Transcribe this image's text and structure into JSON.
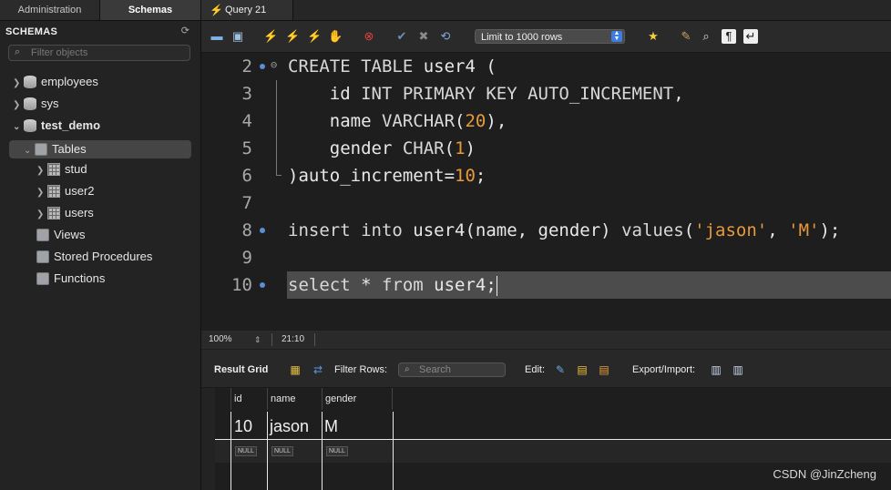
{
  "tabs": {
    "administration": "Administration",
    "schemas": "Schemas",
    "query": "Query 21"
  },
  "sidebar": {
    "title": "SCHEMAS",
    "filter_placeholder": "Filter objects",
    "items": [
      {
        "label": "employees",
        "type": "database",
        "expanded": false
      },
      {
        "label": "sys",
        "type": "database",
        "expanded": false
      },
      {
        "label": "test_demo",
        "type": "database",
        "expanded": true,
        "bold": true
      },
      {
        "label": "Tables",
        "type": "folder",
        "expanded": true,
        "selected": true
      },
      {
        "label": "stud",
        "type": "table"
      },
      {
        "label": "user2",
        "type": "table"
      },
      {
        "label": "users",
        "type": "table"
      },
      {
        "label": "Views",
        "type": "folder"
      },
      {
        "label": "Stored Procedures",
        "type": "folder"
      },
      {
        "label": "Functions",
        "type": "folder"
      }
    ]
  },
  "toolbar": {
    "limit_select": "Limit to 1000 rows",
    "icons": [
      "open-folder-icon",
      "save-icon",
      "execute-bolt-icon",
      "execute-current-bolt-icon",
      "explain-icon",
      "stop-icon",
      "toggle-error-icon",
      "commit-check-icon",
      "rollback-x-icon",
      "autocommit-icon",
      "beautify-star-icon",
      "brush-icon",
      "find-magnifier-icon",
      "invisible-chars-icon",
      "wrap-icon"
    ]
  },
  "editor": {
    "lines": [
      {
        "n": "2",
        "dot": true,
        "fold": true,
        "tokens": [
          [
            "kw",
            "CREATE TABLE "
          ],
          [
            "t",
            "user4 ("
          ]
        ]
      },
      {
        "n": "3",
        "dot": false,
        "tokens": [
          [
            "t",
            "    id "
          ],
          [
            "kw",
            "INT PRIMARY KEY AUTO_INCREMENT"
          ],
          [
            "t",
            ","
          ]
        ]
      },
      {
        "n": "4",
        "dot": false,
        "tokens": [
          [
            "t",
            "    name "
          ],
          [
            "kw",
            "VARCHAR"
          ],
          [
            "t",
            "("
          ],
          [
            "num",
            "20"
          ],
          [
            "t",
            "),"
          ]
        ]
      },
      {
        "n": "5",
        "dot": false,
        "tokens": [
          [
            "t",
            "    gender "
          ],
          [
            "kw",
            "CHAR"
          ],
          [
            "t",
            "("
          ],
          [
            "num",
            "1"
          ],
          [
            "t",
            ")"
          ]
        ]
      },
      {
        "n": "6",
        "dot": false,
        "tokens": [
          [
            "t",
            ")auto_increment="
          ],
          [
            "num",
            "10"
          ],
          [
            "t",
            ";"
          ]
        ]
      },
      {
        "n": "7",
        "dot": false,
        "tokens": []
      },
      {
        "n": "8",
        "dot": true,
        "tokens": [
          [
            "kw",
            "insert into "
          ],
          [
            "t",
            "user4(name, gender) "
          ],
          [
            "kw",
            "values"
          ],
          [
            "t",
            "("
          ],
          [
            "str",
            "'jason'"
          ],
          [
            "t",
            ", "
          ],
          [
            "str",
            "'M'"
          ],
          [
            "t",
            ");"
          ]
        ]
      },
      {
        "n": "9",
        "dot": false,
        "tokens": []
      },
      {
        "n": "10",
        "dot": true,
        "current": true,
        "tokens": [
          [
            "kw",
            "select "
          ],
          [
            "t",
            "* "
          ],
          [
            "kw",
            "from "
          ],
          [
            "t",
            "user4;"
          ]
        ]
      }
    ]
  },
  "status": {
    "zoom": "100%",
    "cursor": "21:10"
  },
  "results": {
    "result_grid_label": "Result Grid",
    "filter_rows_label": "Filter Rows:",
    "search_placeholder": "Search",
    "edit_label": "Edit:",
    "export_label": "Export/Import:",
    "columns": [
      "id",
      "name",
      "gender"
    ],
    "rows": [
      [
        "10",
        "jason",
        "M"
      ],
      [
        "NULL",
        "NULL",
        "NULL"
      ]
    ]
  },
  "watermark": "CSDN @JinZcheng"
}
